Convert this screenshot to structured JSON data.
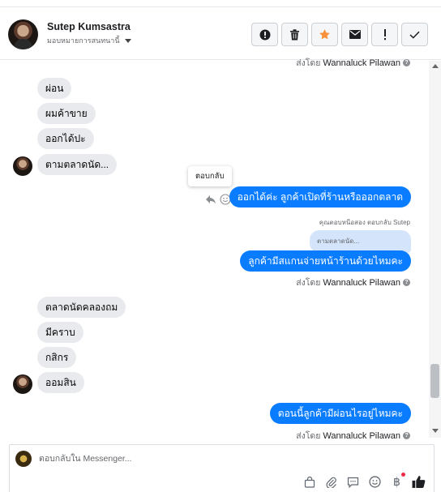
{
  "header": {
    "contact_name": "Sutep Kumsastra",
    "assign_label": "มอบหมายการสนทนานี้",
    "actions": [
      {
        "name": "spam-button",
        "icon": "exclamation-circle-icon"
      },
      {
        "name": "delete-button",
        "icon": "trash-icon"
      },
      {
        "name": "star-button",
        "icon": "star-icon"
      },
      {
        "name": "mark-unread-button",
        "icon": "envelope-icon"
      },
      {
        "name": "follow-up-button",
        "icon": "exclamation-icon"
      },
      {
        "name": "done-button",
        "icon": "check-icon"
      }
    ],
    "star_color": "#f7923b"
  },
  "thread": {
    "top_sent_by": {
      "prefix": "ส่งโดย",
      "name": "Wannaluck Pilawan"
    },
    "incoming_1": [
      "ผ่อน",
      "ผมค้าขาย",
      "ออกได้ปะ",
      "ตามตลาดนัด..."
    ],
    "reply_tooltip": "ตอบกลับ",
    "outgoing_1": "ออกได้ค่ะ ลูกค้าเปิดที่ร้านหรือออกตลาด",
    "reply_note": "คุณตอบหนีอสอง ตอบกลับ Sutep",
    "quoted_text": "ตามตลาดนัด...",
    "outgoing_2": "ลูกค้ามีสแกนจ่ายหน้าร้านด้วยไหมคะ",
    "sent_by_2": {
      "prefix": "ส่งโดย",
      "name": "Wannaluck Pilawan"
    },
    "incoming_2": [
      "ตลาดนัดคลองถม",
      "มีคราบ",
      "กสิกร",
      "ออมสิน"
    ],
    "outgoing_3": "ตอนนี้ลูกค้ามีผ่อนไรอยู่ไหมคะ",
    "sent_by_3": {
      "prefix": "ส่งโดย",
      "name": "Wannaluck Pilawan"
    }
  },
  "composer": {
    "placeholder": "ตอบกลับใน Messenger...",
    "tools": [
      "shop-bag-icon",
      "paperclip-icon",
      "saved-replies-icon",
      "emoji-icon",
      "baht-icon",
      "thumbs-up-icon"
    ]
  },
  "colors": {
    "outgoing_bubble": "#0a7cff",
    "incoming_bubble": "#e9eaee",
    "notification_dot": "#f02849"
  }
}
